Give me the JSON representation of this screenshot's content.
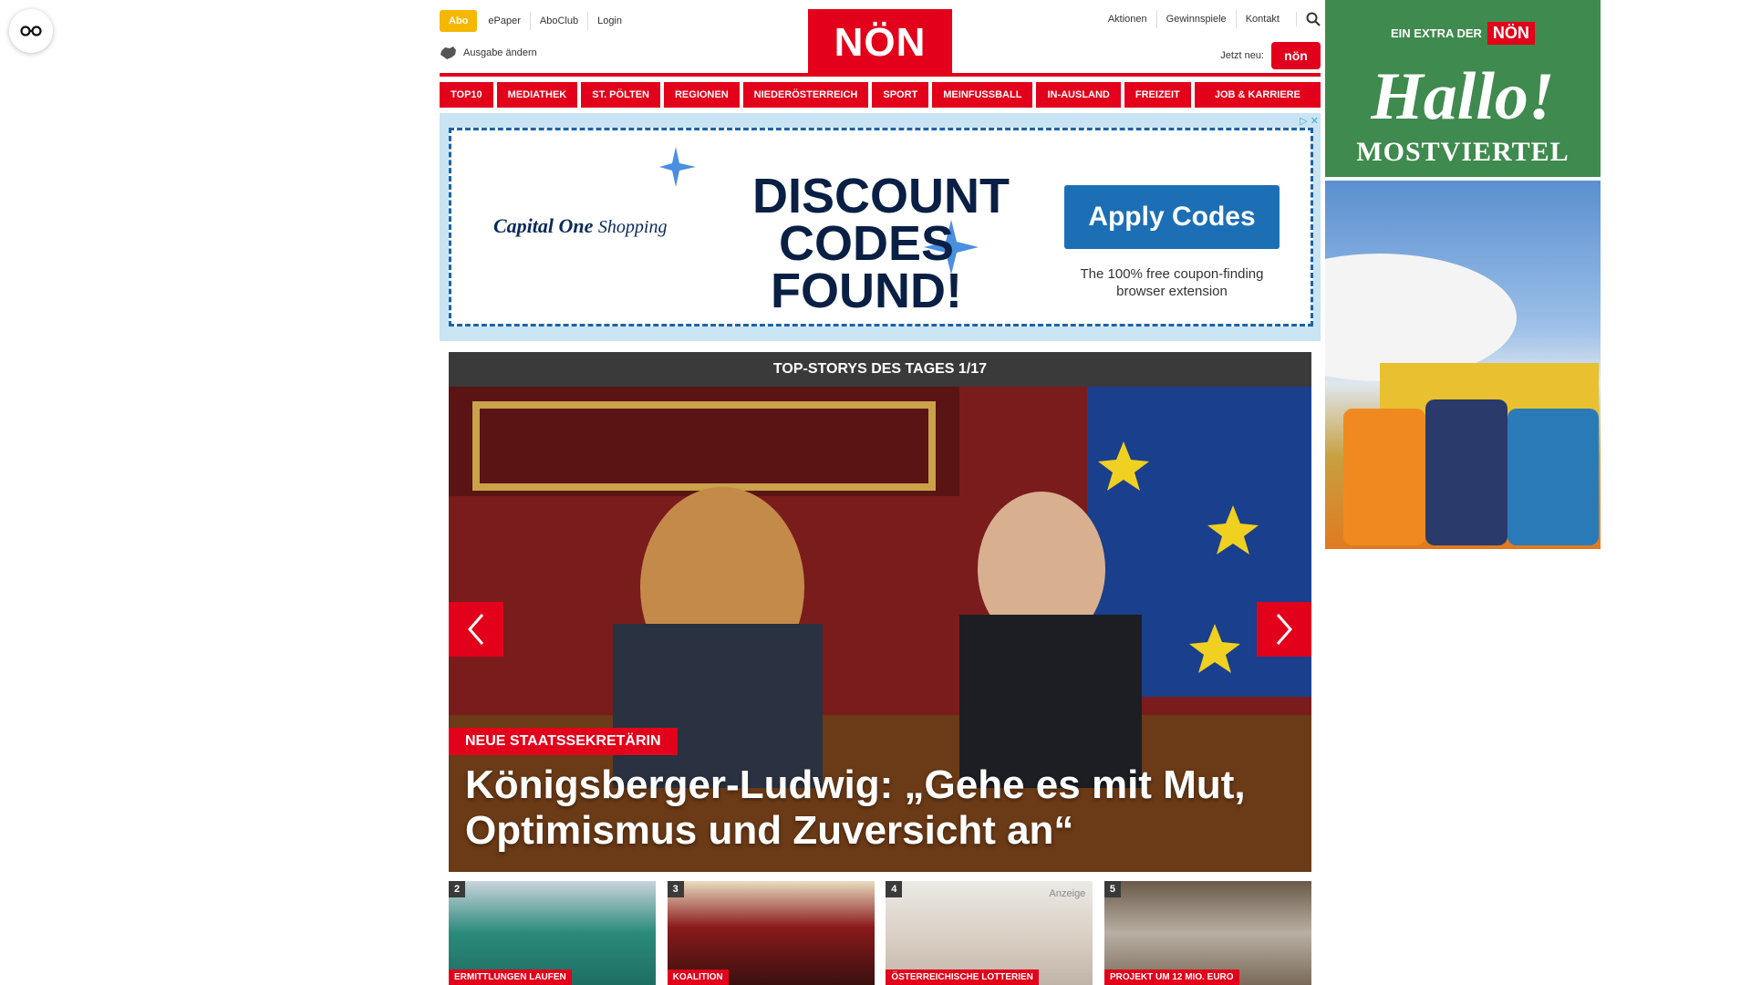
{
  "header": {
    "abo": "Abo",
    "links_left": [
      "ePaper",
      "AboClub",
      "Login"
    ],
    "ausgabe": "Ausgabe ändern",
    "logo": "NÖN",
    "links_right": [
      "Aktionen",
      "Gewinnspiele",
      "Kontakt"
    ],
    "jetzt_neu": "Jetzt neu:",
    "kleine_badge": "nön"
  },
  "nav": [
    "TOP10",
    "MEDIATHEK",
    "ST. PÖLTEN",
    "REGIONEN",
    "NIEDERÖSTERREICH",
    "SPORT",
    "MEINFUSSBALL",
    "IN-AUSLAND",
    "FREIZEIT",
    "JOB & KARRIERE"
  ],
  "ad": {
    "brand": "Capital One",
    "brand_suffix": "Shopping",
    "headline": "DISCOUNT CODES FOUND!",
    "button": "Apply Codes",
    "subtext": "The 100% free coupon-finding browser extension"
  },
  "hero": {
    "heading": "TOP-STORYS DES TAGES 1/17",
    "tag": "NEUE STAATSSEKRETÄRIN",
    "headline": "Königsberger-Ludwig: „Gehe es mit Mut, Optimismus und Zuversicht an“"
  },
  "thumbs": [
    {
      "num": "2",
      "tag": "ERMITTLUNGEN LAUFEN",
      "anzeige": ""
    },
    {
      "num": "3",
      "tag": "KOALITION",
      "anzeige": ""
    },
    {
      "num": "4",
      "tag": "ÖSTERREICHISCHE LOTTERIEN",
      "anzeige": "Anzeige"
    },
    {
      "num": "5",
      "tag": "PROJEKT UM 12 MIO. EURO",
      "anzeige": ""
    }
  ],
  "right_ad": {
    "extra": "EIN EXTRA DER",
    "nonbox": "NÖN",
    "big": "Hallo!",
    "region": "MOSTVIERTEL"
  },
  "colors": {
    "brand_red": "#e2001a",
    "abo_yellow": "#f5b700",
    "ad_blue": "#1c6fb5",
    "hallo_green": "#3f8a4e"
  }
}
